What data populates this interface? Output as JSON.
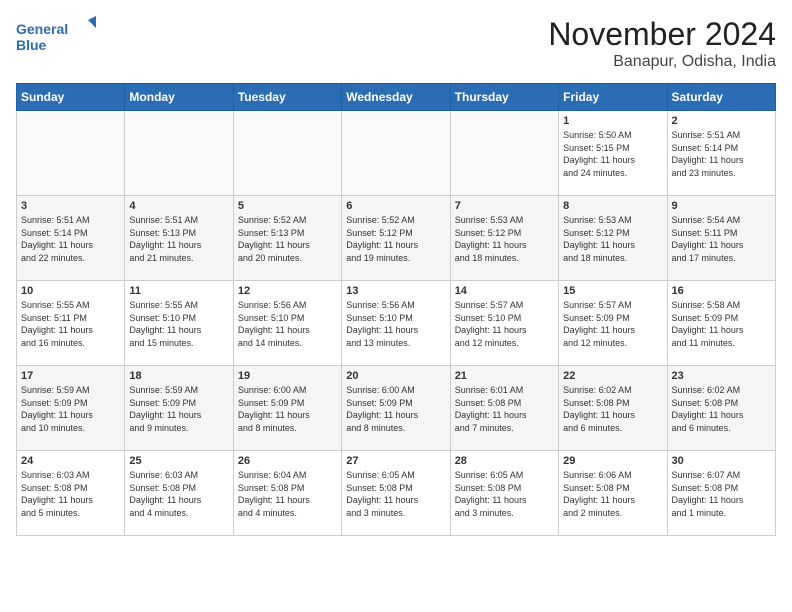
{
  "logo": {
    "line1": "General",
    "line2": "Blue"
  },
  "title": "November 2024",
  "location": "Banapur, Odisha, India",
  "weekdays": [
    "Sunday",
    "Monday",
    "Tuesday",
    "Wednesday",
    "Thursday",
    "Friday",
    "Saturday"
  ],
  "weeks": [
    [
      {
        "day": "",
        "text": ""
      },
      {
        "day": "",
        "text": ""
      },
      {
        "day": "",
        "text": ""
      },
      {
        "day": "",
        "text": ""
      },
      {
        "day": "",
        "text": ""
      },
      {
        "day": "1",
        "text": "Sunrise: 5:50 AM\nSunset: 5:15 PM\nDaylight: 11 hours\nand 24 minutes."
      },
      {
        "day": "2",
        "text": "Sunrise: 5:51 AM\nSunset: 5:14 PM\nDaylight: 11 hours\nand 23 minutes."
      }
    ],
    [
      {
        "day": "3",
        "text": "Sunrise: 5:51 AM\nSunset: 5:14 PM\nDaylight: 11 hours\nand 22 minutes."
      },
      {
        "day": "4",
        "text": "Sunrise: 5:51 AM\nSunset: 5:13 PM\nDaylight: 11 hours\nand 21 minutes."
      },
      {
        "day": "5",
        "text": "Sunrise: 5:52 AM\nSunset: 5:13 PM\nDaylight: 11 hours\nand 20 minutes."
      },
      {
        "day": "6",
        "text": "Sunrise: 5:52 AM\nSunset: 5:12 PM\nDaylight: 11 hours\nand 19 minutes."
      },
      {
        "day": "7",
        "text": "Sunrise: 5:53 AM\nSunset: 5:12 PM\nDaylight: 11 hours\nand 18 minutes."
      },
      {
        "day": "8",
        "text": "Sunrise: 5:53 AM\nSunset: 5:12 PM\nDaylight: 11 hours\nand 18 minutes."
      },
      {
        "day": "9",
        "text": "Sunrise: 5:54 AM\nSunset: 5:11 PM\nDaylight: 11 hours\nand 17 minutes."
      }
    ],
    [
      {
        "day": "10",
        "text": "Sunrise: 5:55 AM\nSunset: 5:11 PM\nDaylight: 11 hours\nand 16 minutes."
      },
      {
        "day": "11",
        "text": "Sunrise: 5:55 AM\nSunset: 5:10 PM\nDaylight: 11 hours\nand 15 minutes."
      },
      {
        "day": "12",
        "text": "Sunrise: 5:56 AM\nSunset: 5:10 PM\nDaylight: 11 hours\nand 14 minutes."
      },
      {
        "day": "13",
        "text": "Sunrise: 5:56 AM\nSunset: 5:10 PM\nDaylight: 11 hours\nand 13 minutes."
      },
      {
        "day": "14",
        "text": "Sunrise: 5:57 AM\nSunset: 5:10 PM\nDaylight: 11 hours\nand 12 minutes."
      },
      {
        "day": "15",
        "text": "Sunrise: 5:57 AM\nSunset: 5:09 PM\nDaylight: 11 hours\nand 12 minutes."
      },
      {
        "day": "16",
        "text": "Sunrise: 5:58 AM\nSunset: 5:09 PM\nDaylight: 11 hours\nand 11 minutes."
      }
    ],
    [
      {
        "day": "17",
        "text": "Sunrise: 5:59 AM\nSunset: 5:09 PM\nDaylight: 11 hours\nand 10 minutes."
      },
      {
        "day": "18",
        "text": "Sunrise: 5:59 AM\nSunset: 5:09 PM\nDaylight: 11 hours\nand 9 minutes."
      },
      {
        "day": "19",
        "text": "Sunrise: 6:00 AM\nSunset: 5:09 PM\nDaylight: 11 hours\nand 8 minutes."
      },
      {
        "day": "20",
        "text": "Sunrise: 6:00 AM\nSunset: 5:09 PM\nDaylight: 11 hours\nand 8 minutes."
      },
      {
        "day": "21",
        "text": "Sunrise: 6:01 AM\nSunset: 5:08 PM\nDaylight: 11 hours\nand 7 minutes."
      },
      {
        "day": "22",
        "text": "Sunrise: 6:02 AM\nSunset: 5:08 PM\nDaylight: 11 hours\nand 6 minutes."
      },
      {
        "day": "23",
        "text": "Sunrise: 6:02 AM\nSunset: 5:08 PM\nDaylight: 11 hours\nand 6 minutes."
      }
    ],
    [
      {
        "day": "24",
        "text": "Sunrise: 6:03 AM\nSunset: 5:08 PM\nDaylight: 11 hours\nand 5 minutes."
      },
      {
        "day": "25",
        "text": "Sunrise: 6:03 AM\nSunset: 5:08 PM\nDaylight: 11 hours\nand 4 minutes."
      },
      {
        "day": "26",
        "text": "Sunrise: 6:04 AM\nSunset: 5:08 PM\nDaylight: 11 hours\nand 4 minutes."
      },
      {
        "day": "27",
        "text": "Sunrise: 6:05 AM\nSunset: 5:08 PM\nDaylight: 11 hours\nand 3 minutes."
      },
      {
        "day": "28",
        "text": "Sunrise: 6:05 AM\nSunset: 5:08 PM\nDaylight: 11 hours\nand 3 minutes."
      },
      {
        "day": "29",
        "text": "Sunrise: 6:06 AM\nSunset: 5:08 PM\nDaylight: 11 hours\nand 2 minutes."
      },
      {
        "day": "30",
        "text": "Sunrise: 6:07 AM\nSunset: 5:08 PM\nDaylight: 11 hours\nand 1 minute."
      }
    ]
  ]
}
